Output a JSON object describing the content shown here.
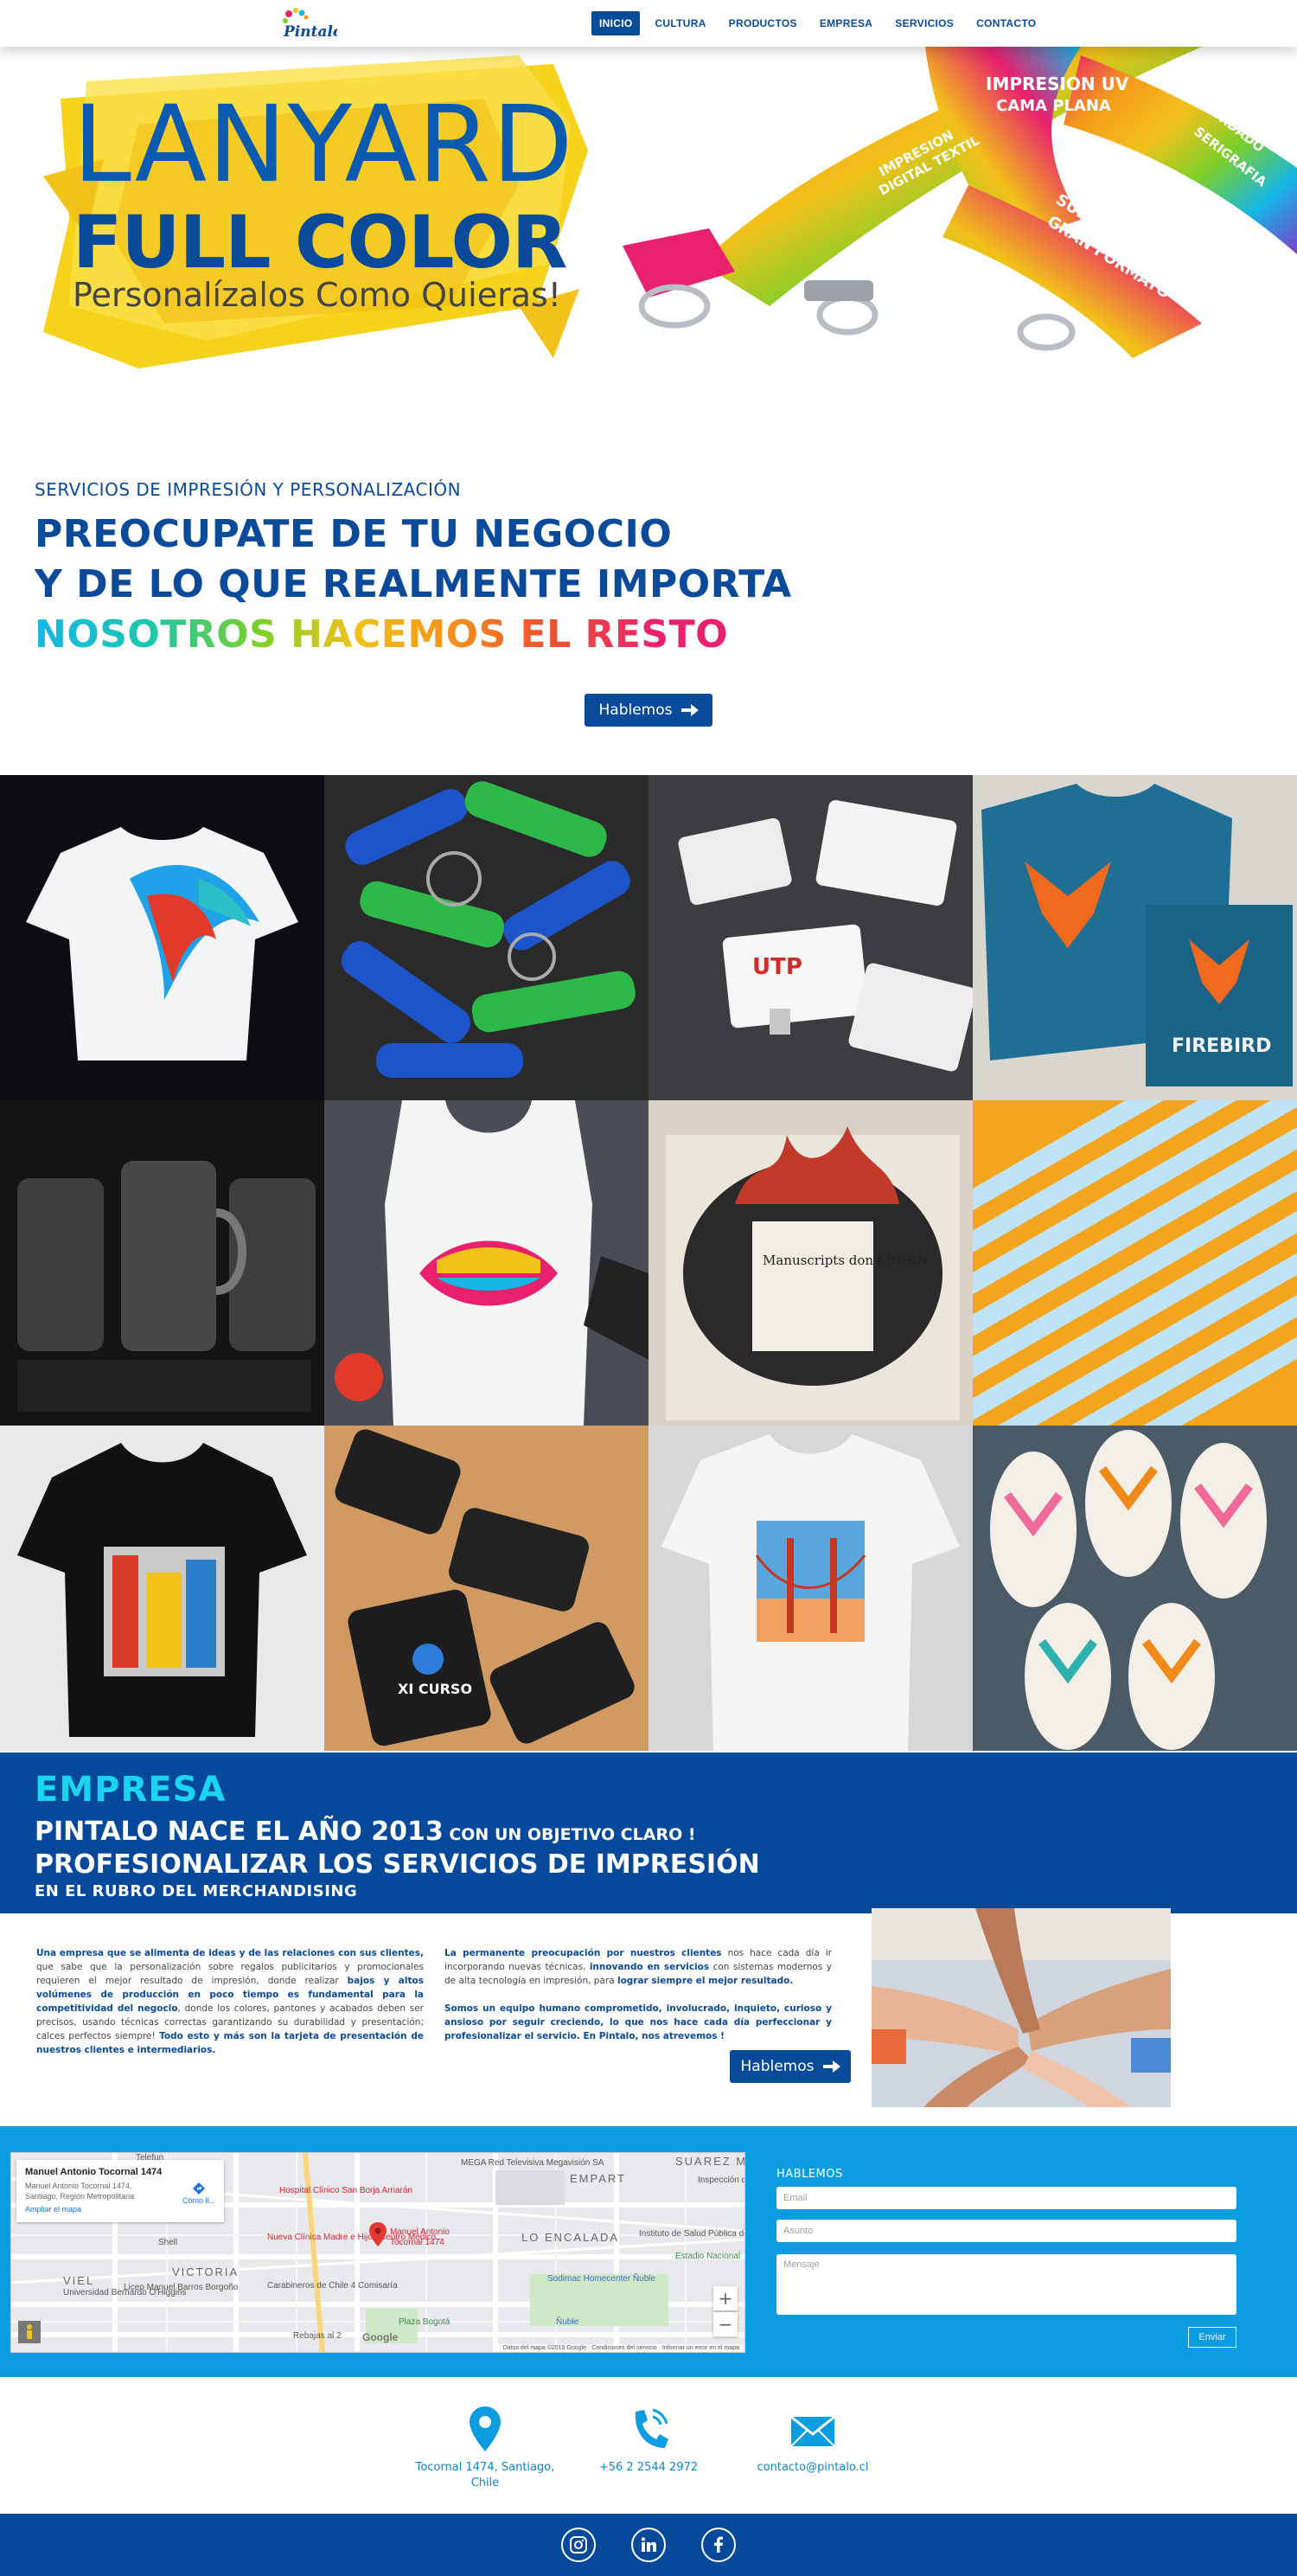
{
  "nav": {
    "items": [
      {
        "label": "INICIO",
        "active": true
      },
      {
        "label": "CULTURA",
        "active": false
      },
      {
        "label": "PRODUCTOS",
        "active": false
      },
      {
        "label": "EMPRESA",
        "active": false
      },
      {
        "label": "SERVICIOS",
        "active": false
      },
      {
        "label": "CONTACTO",
        "active": false
      }
    ]
  },
  "hero": {
    "title_line1": "LANYARD",
    "title_line2": "FULL COLOR",
    "subtitle": "Personalízalos Como Quieras!",
    "tags": [
      "IMPRESION UV",
      "CAMA PLANA",
      "IMPRESION",
      "DIGITAL TEXTIL",
      "SUBLIMACION",
      "GRAN FORMATO",
      "SERIGRAFIA",
      "BORDADO"
    ]
  },
  "intro": {
    "kicker": "SERVICIOS DE IMPRESIÓN Y PERSONALIZACIÓN",
    "line1": "PREOCUPATE DE TU NEGOCIO",
    "line2": "Y DE LO QUE REALMENTE IMPORTA",
    "line3": "NOSOTROS HACEMOS EL RESTO",
    "button_label": "Hablemos"
  },
  "gallery": {
    "items": [
      {
        "icon": "tshirt-parrot-image"
      },
      {
        "icon": "bottle-opener-keychains-image"
      },
      {
        "icon": "usb-cards-image"
      },
      {
        "icon": "firebird-shirt-bag-image"
      },
      {
        "icon": "glass-mugs-image"
      },
      {
        "icon": "tank-top-lips-image"
      },
      {
        "icon": "tote-bag-book-image"
      },
      {
        "icon": "pens-image"
      },
      {
        "icon": "black-tshirt-city-image"
      },
      {
        "icon": "usb-leather-image"
      },
      {
        "icon": "tshirt-bridge-image"
      },
      {
        "icon": "flipflop-openers-image"
      }
    ],
    "printed_text": {
      "usb_card": "UTP",
      "usb_leather": "XI CURSO",
      "firebird": "FIREBIRD",
      "book": "Manuscripts don't BURN"
    }
  },
  "empresa": {
    "heading": "EMPRESA",
    "line1_big": "PINTALO NACE EL AÑO 2013",
    "line1_small": " CON UN OBJETIVO CLARO !",
    "line2": "PROFESIONALIZAR LOS SERVICIOS DE IMPRESIÓN",
    "line3": "EN EL RUBRO DEL MERCHANDISING",
    "col1": [
      {
        "b": true,
        "t": "Una empresa que se alimenta de ideas y de las relaciones con sus clientes,"
      },
      {
        "b": false,
        "t": " que sabe que la personalización sobre regalos publicitarios y promocionales requieren el mejor resultado de impresión, donde realizar "
      },
      {
        "b": true,
        "t": "bajos y altos volúmenes de producción en poco tiempo es fundamental para la competitividad del negocio"
      },
      {
        "b": false,
        "t": ", donde los colores, pantones y acabados deben ser precisos, usando técnicas correctas garantizando su durabilidad y presentación; calces perfectos siempre! "
      },
      {
        "b": true,
        "t": "Todo esto y más son la tarjeta de presentación de nuestros clientes e intermediarios."
      }
    ],
    "col2_p1": [
      {
        "b": true,
        "t": "La permanente preocupación por nuestros clientes"
      },
      {
        "b": false,
        "t": " nos hace cada día ir incorporando nuevas técnicas, "
      },
      {
        "b": true,
        "t": "innovando en servicios"
      },
      {
        "b": false,
        "t": " con sistemas modernos y de alta tecnología en impresión, para "
      },
      {
        "b": true,
        "t": "lograr siempre el mejor resultado."
      }
    ],
    "col2_p2": [
      {
        "b": true,
        "t": "Somos un equipo humano comprometido, involucrado, inquieto, curioso y ansioso por seguir creciendo, lo que nos hace cada día perfeccionar y profesionalizar el servicio. En Pintalo, nos atrevemos !"
      }
    ],
    "button_label": "Hablemos",
    "image_icon": "team-hands-image"
  },
  "map": {
    "card_title": "Manuel Antonio Tocornal 1474",
    "card_address": "Manuel Antonio Tocornal 1474, Santiago, Región Metropolitana",
    "card_link": "Ampliar el mapa",
    "card_directions": "Cómo ll...",
    "pin_label_1": "Manuel Antonio",
    "pin_label_2": "Tocornal 1474",
    "labels": [
      {
        "text": "SUAREZ MU",
        "cls": "big"
      },
      {
        "text": "EMPART",
        "cls": "big"
      },
      {
        "text": "LO ENCALADA",
        "cls": "big"
      },
      {
        "text": "VICTORIA",
        "cls": "big"
      },
      {
        "text": "VIEL",
        "cls": "big"
      },
      {
        "text": "MEGA Red Televisiva Megavisión SA",
        "cls": ""
      },
      {
        "text": "Hospital Clínico San Borja Arriarán",
        "cls": "red"
      },
      {
        "text": "Nueva Clínica Madre e Hijo / Centro Médico...",
        "cls": "red"
      },
      {
        "text": "Instituto de Salud Pública de Chile",
        "cls": ""
      },
      {
        "text": "Estadio Nacional",
        "cls": "green"
      },
      {
        "text": "Sodimac Homecenter Ñuble",
        "cls": "blue"
      },
      {
        "text": "Carabineros de Chile 4 Comisaría",
        "cls": ""
      },
      {
        "text": "Liceo Manuel Barros Borgoño",
        "cls": ""
      },
      {
        "text": "Plaza Bogotá",
        "cls": "green"
      },
      {
        "text": "Ñuble",
        "cls": "blue"
      },
      {
        "text": "Shell",
        "cls": ""
      },
      {
        "text": "Universidad Bernardo O'Higgins",
        "cls": ""
      },
      {
        "text": "Rebajas al 2",
        "cls": ""
      },
      {
        "text": "Telefun",
        "cls": ""
      },
      {
        "text": "Inspección del Trabajo Sa...",
        "cls": ""
      }
    ],
    "footer_text": "Datos del mapa ©2019 Google · Condiciones del servicio · Informar un error en el mapa",
    "google_label": "Google",
    "zoom_in": "+",
    "zoom_out": "−"
  },
  "form": {
    "title": "HABLEMOS",
    "email_placeholder": "Email",
    "subject_placeholder": "Asunto",
    "message_placeholder": "Mensaje",
    "send_label": "Enviar"
  },
  "contact": {
    "address": "Tocornal 1474, Santiago, Chile",
    "phone": "+56 2 2544 2972",
    "email": "contacto@pintalo.cl"
  },
  "colors": {
    "primary": "#0a4a9a",
    "accent_cyan": "#1ad4f0",
    "contact_band": "#0b9de0",
    "footer": "#06499a"
  }
}
